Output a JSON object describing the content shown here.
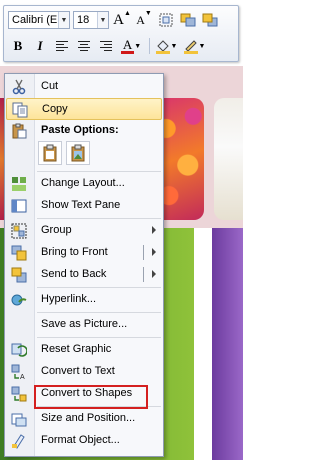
{
  "toolbar": {
    "font_name": "Calibri (E",
    "font_size": "18",
    "grow_font": "A",
    "shrink_font": "A",
    "bold": "B",
    "italic": "I",
    "font_color_letter": "A",
    "font_color": "#d01818"
  },
  "menu": {
    "items": [
      {
        "label": "Cut",
        "icon": "scissors-icon"
      },
      {
        "label": "Copy",
        "icon": "copy-icon",
        "highlighted": true
      },
      {
        "label": "Paste Options:",
        "icon": "paste-icon"
      },
      {
        "label": "Change Layout...",
        "icon": "layout-icon"
      },
      {
        "label": "Show Text Pane",
        "icon": "text-pane-icon"
      },
      {
        "label": "Group",
        "icon": "group-icon",
        "submenu": true
      },
      {
        "label": "Bring to Front",
        "icon": "bring-front-icon",
        "submenu": true
      },
      {
        "label": "Send to Back",
        "icon": "send-back-icon",
        "submenu": true
      },
      {
        "label": "Hyperlink...",
        "icon": "hyperlink-icon"
      },
      {
        "label": "Save as Picture...",
        "icon": "save-picture-icon"
      },
      {
        "label": "Reset Graphic",
        "icon": "reset-graphic-icon"
      },
      {
        "label": "Convert to Text",
        "icon": "convert-text-icon"
      },
      {
        "label": "Convert to Shapes",
        "icon": "convert-shapes-icon",
        "outlined": true
      },
      {
        "label": "Size and Position...",
        "icon": "size-position-icon"
      },
      {
        "label": "Format Object...",
        "icon": "format-object-icon"
      }
    ]
  },
  "colors": {
    "highlight": "#fde49a",
    "outline": "#d42020",
    "green_block": "#6aa82c",
    "purple_block": "#9a68c8",
    "pink_band": "#ecd5d8"
  }
}
